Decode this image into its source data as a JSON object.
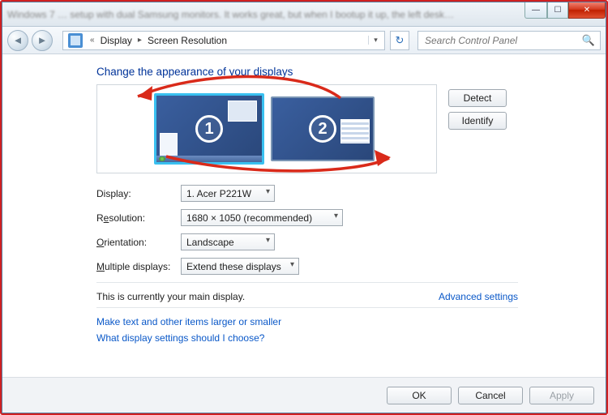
{
  "titlebar": {
    "blurred_text": "Windows 7 … setup with dual Samsung monitors. It works great, but when I bootup it up, the left desk…"
  },
  "breadcrumb": {
    "root": "«",
    "items": [
      "Display",
      "Screen Resolution"
    ]
  },
  "search": {
    "placeholder": "Search Control Panel"
  },
  "heading": "Change the appearance of your displays",
  "monitors": {
    "m1": "1",
    "m2": "2"
  },
  "buttons": {
    "detect": "Detect",
    "identify": "Identify"
  },
  "form": {
    "display_label": "Display:",
    "display_value": "1. Acer P221W",
    "resolution_label_pre": "R",
    "resolution_label_u": "e",
    "resolution_label_post": "solution:",
    "resolution_value": "1680 × 1050 (recommended)",
    "orientation_label_pre": "",
    "orientation_label_u": "O",
    "orientation_label_post": "rientation:",
    "orientation_value": "Landscape",
    "multiple_label_pre": "",
    "multiple_label_u": "M",
    "multiple_label_post": "ultiple displays:",
    "multiple_value": "Extend these displays"
  },
  "status": "This is currently your main display.",
  "links": {
    "advanced": "Advanced settings",
    "larger": "Make text and other items larger or smaller",
    "which": "What display settings should I choose?"
  },
  "footer": {
    "ok": "OK",
    "cancel": "Cancel",
    "apply": "Apply"
  }
}
